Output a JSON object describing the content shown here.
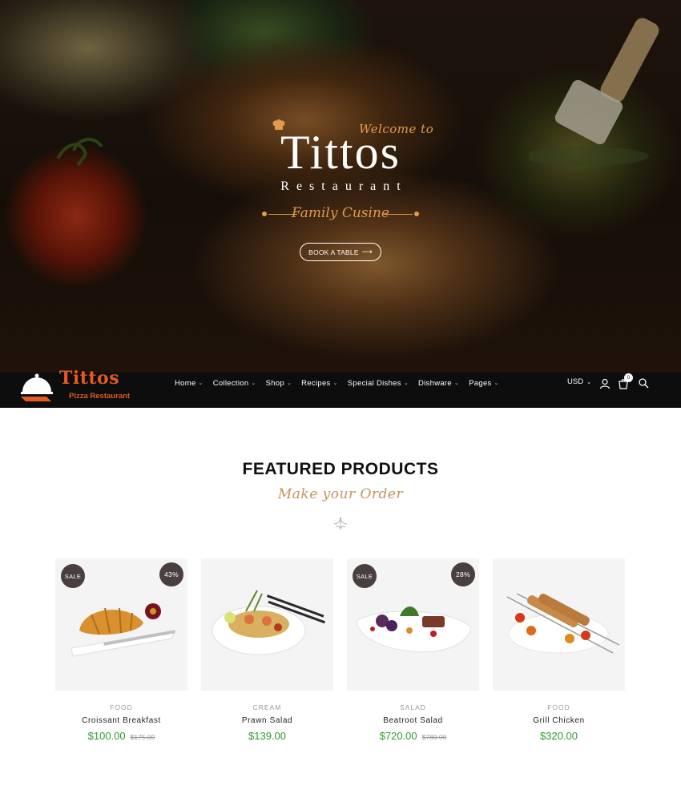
{
  "hero": {
    "welcome": "Welcome to",
    "brand": "Tittos",
    "subtitle": "Restaurant",
    "tagline": "Family Cusine",
    "button_label": "BOOK A TABLE"
  },
  "logo": {
    "name": "Tittos",
    "subtitle": "Pizza Restaurant"
  },
  "nav": {
    "items": [
      {
        "label": "Home"
      },
      {
        "label": "Collection"
      },
      {
        "label": "Shop"
      },
      {
        "label": "Recipes"
      },
      {
        "label": "Special Dishes"
      },
      {
        "label": "Dishware"
      },
      {
        "label": "Pages"
      }
    ],
    "currency": "USD",
    "cart_count": "0",
    "icons": [
      "user-icon",
      "cart-icon",
      "search-icon"
    ]
  },
  "featured": {
    "title": "FEATURED PRODUCTS",
    "subtitle": "Make your Order"
  },
  "products": [
    {
      "category": "FOOD",
      "name": "Croissant Breakfast",
      "price": "$100.00",
      "old_price": "$175.00",
      "sale": "SALE",
      "discount": "43%"
    },
    {
      "category": "CREAM",
      "name": "Prawn Salad",
      "price": "$139.00",
      "old_price": "",
      "sale": "",
      "discount": ""
    },
    {
      "category": "SALAD",
      "name": "Beatroot Salad",
      "price": "$720.00",
      "old_price": "$780.00",
      "sale": "SALE",
      "discount": "28%"
    },
    {
      "category": "FOOD",
      "name": "Grill Chicken",
      "price": "$320.00",
      "old_price": "",
      "sale": "",
      "discount": ""
    }
  ],
  "colors": {
    "accent_orange": "#e39a4a",
    "logo_orange": "#e55a1f",
    "price_green": "#2e9a2e",
    "badge_dark": "#4a3f3f",
    "navbar": "#0d0d0d"
  }
}
